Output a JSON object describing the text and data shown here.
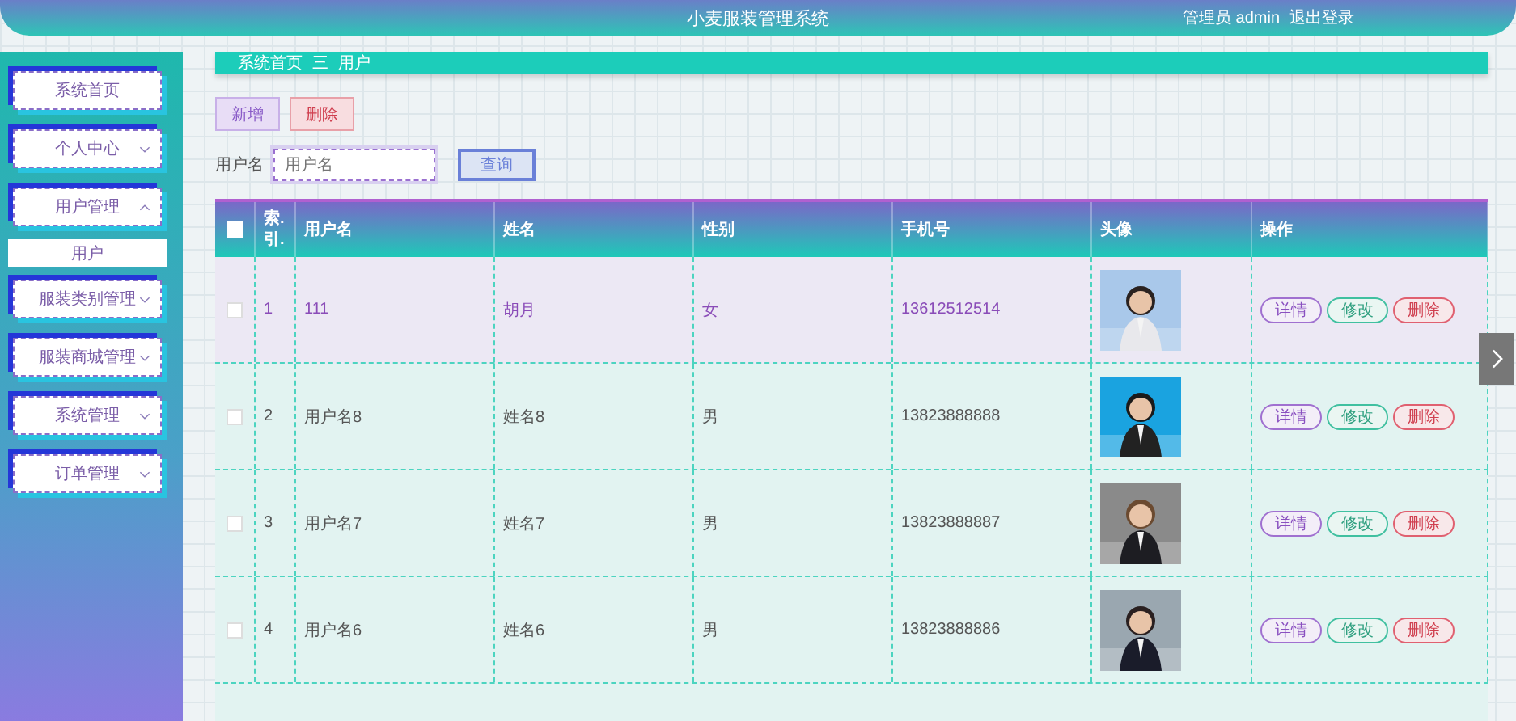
{
  "header": {
    "title": "小麦服装管理系统",
    "user": "管理员 admin",
    "logout": "退出登录"
  },
  "sidebar": {
    "items": [
      {
        "label": "系统首页",
        "kind": "link"
      },
      {
        "label": "个人中心",
        "kind": "menu",
        "expanded": false
      },
      {
        "label": "用户管理",
        "kind": "menu",
        "expanded": true,
        "children": [
          {
            "label": "用户"
          }
        ]
      },
      {
        "label": "服装类别管理",
        "kind": "menu",
        "expanded": false
      },
      {
        "label": "服装商城管理",
        "kind": "menu",
        "expanded": false
      },
      {
        "label": "系统管理",
        "kind": "menu",
        "expanded": false
      },
      {
        "label": "订单管理",
        "kind": "menu",
        "expanded": false
      }
    ]
  },
  "breadcrumb": {
    "home": "系统首页",
    "separator": "三",
    "current": "用户"
  },
  "toolbar": [
    {
      "label": "新增",
      "kind": "add"
    },
    {
      "label": "删除",
      "kind": "delete"
    }
  ],
  "search": {
    "label": "用户名",
    "placeholder": "用户名",
    "button": "查询"
  },
  "table": {
    "select_all": {
      "checked": false
    },
    "columns": [
      "索.引.",
      "用户名",
      "姓名",
      "性别",
      "手机号",
      "头像",
      "操作"
    ],
    "rows": [
      {
        "checked": false,
        "highlighted": true,
        "index": "1",
        "username": "111",
        "name": "胡月",
        "gender": "女",
        "phone": "13612512514",
        "avatar": {
          "kind": "picture"
        },
        "actions": [
          {
            "label": "详情",
            "kind": "detail"
          },
          {
            "label": "修改",
            "kind": "edit"
          },
          {
            "label": "删除",
            "kind": "delete"
          }
        ]
      },
      {
        "checked": false,
        "highlighted": false,
        "index": "2",
        "username": "用户名8",
        "name": "姓名8",
        "gender": "男",
        "phone": "13823888888",
        "avatar": {
          "kind": "picture"
        },
        "actions": [
          {
            "label": "详情",
            "kind": "detail"
          },
          {
            "label": "修改",
            "kind": "edit"
          },
          {
            "label": "删除",
            "kind": "delete"
          }
        ]
      },
      {
        "checked": false,
        "highlighted": false,
        "index": "3",
        "username": "用户名7",
        "name": "姓名7",
        "gender": "男",
        "phone": "13823888887",
        "avatar": {
          "kind": "picture"
        },
        "actions": [
          {
            "label": "详情",
            "kind": "detail"
          },
          {
            "label": "修改",
            "kind": "edit"
          },
          {
            "label": "删除",
            "kind": "delete"
          }
        ]
      },
      {
        "checked": false,
        "highlighted": false,
        "index": "4",
        "username": "用户名6",
        "name": "姓名6",
        "gender": "男",
        "phone": "13823888886",
        "avatar": {
          "kind": "picture"
        },
        "actions": [
          {
            "label": "详情",
            "kind": "detail"
          },
          {
            "label": "修改",
            "kind": "edit"
          },
          {
            "label": "删除",
            "kind": "delete"
          }
        ]
      }
    ]
  }
}
